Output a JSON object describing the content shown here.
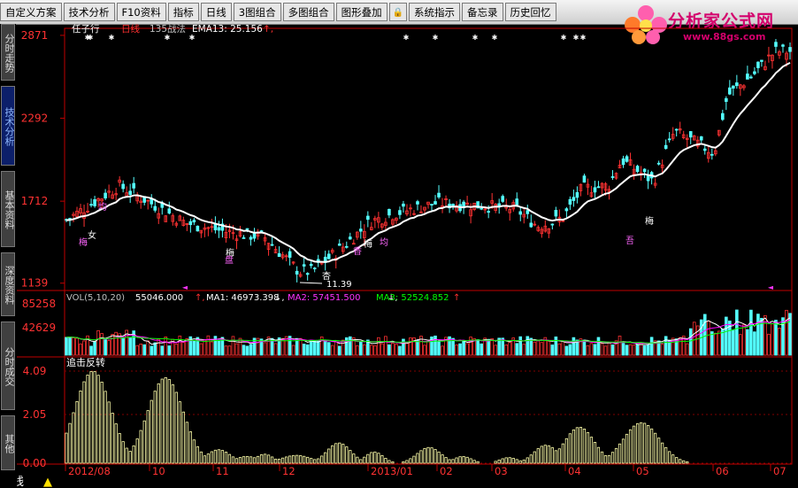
{
  "toolbar": {
    "items": [
      "自定义方案",
      "技术分析",
      "F10资料",
      "指标",
      "日线",
      "3图组合",
      "多图组合",
      "图形叠加",
      "系统指示",
      "备忘录",
      "历史回忆"
    ],
    "lock_icon": "lock-icon"
  },
  "logo": {
    "text": "分析家公式网",
    "url": "www.88gs.com"
  },
  "sidetabs": [
    "分时走势",
    "技术分析",
    "基本资料",
    "深度资料",
    "分时成交",
    "其他"
  ],
  "price_panel": {
    "stock": "任子行",
    "period": "日线",
    "indicator": "135战法",
    "ema_label": "EMA13: 25.156",
    "ema_arrow": "↑,",
    "yticks": [
      "2871",
      "2292",
      "1712",
      "1139"
    ],
    "low_label": "11.39",
    "marks": [
      "梅",
      "女",
      "均",
      "梅",
      "香",
      "梅",
      "均",
      "杏",
      "吾",
      "梅",
      "盘"
    ]
  },
  "volume_panel": {
    "title": "VOL(5,10,20)",
    "vol": "55046.000",
    "vol_arrow": "↑,",
    "ma1": "MA1: 46973.398",
    "ma1_arrow": "↓,",
    "ma2": "MA2: 57451.500",
    "ma2_arrow": "↓,",
    "ma3": "MA3: 52524.852",
    "ma3_arrow": "↑",
    "yticks": [
      "85258",
      "42629"
    ]
  },
  "osc_panel": {
    "title": "追击反转",
    "yticks": [
      "4.09",
      "2.05",
      "0.00"
    ]
  },
  "xaxis": [
    "2012/08",
    "10",
    "11",
    "12",
    "2013/01",
    "02",
    "03",
    "04",
    "05",
    "06",
    "07"
  ],
  "bottom": {
    "period_label": "日线"
  },
  "colors": {
    "up": "#ff3232",
    "down": "#54ffff",
    "ma1": "#ffffff",
    "ma2": "#ff00ff",
    "ma3": "#00ff00",
    "osc": "#ffffaa",
    "axis": "#c00000"
  }
}
